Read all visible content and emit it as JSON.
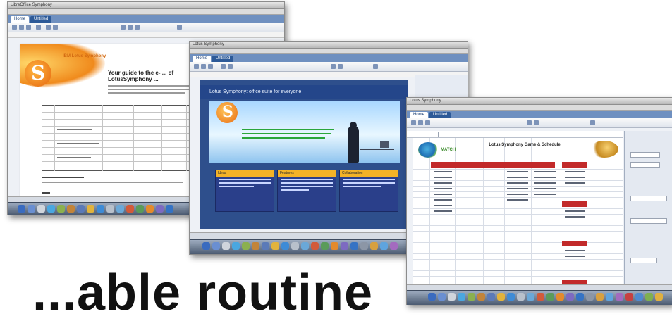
{
  "windows": {
    "document": {
      "title": "LibreOffice Symphony",
      "tab_home": "Home",
      "tab_file": "Untitled",
      "heading": "Your guide to the e- ... of LotusSymphony ...",
      "brand": "IBM Lotus Symphony"
    },
    "presentation": {
      "title": "Lotus Symphony",
      "tab_home": "Home",
      "tab_file": "Untitled",
      "slide_title": "Lotus Symphony: office suite for everyone",
      "box1": "Ideas",
      "box2": "Features",
      "box3": "Collaboration"
    },
    "spreadsheet": {
      "title": "Lotus Symphony",
      "tab_home": "Home",
      "tab_file": "Untitled",
      "sheet_title": "Lotus Symphony Game & Schedule",
      "logo": "MATCH"
    }
  },
  "caption": "...able routine"
}
